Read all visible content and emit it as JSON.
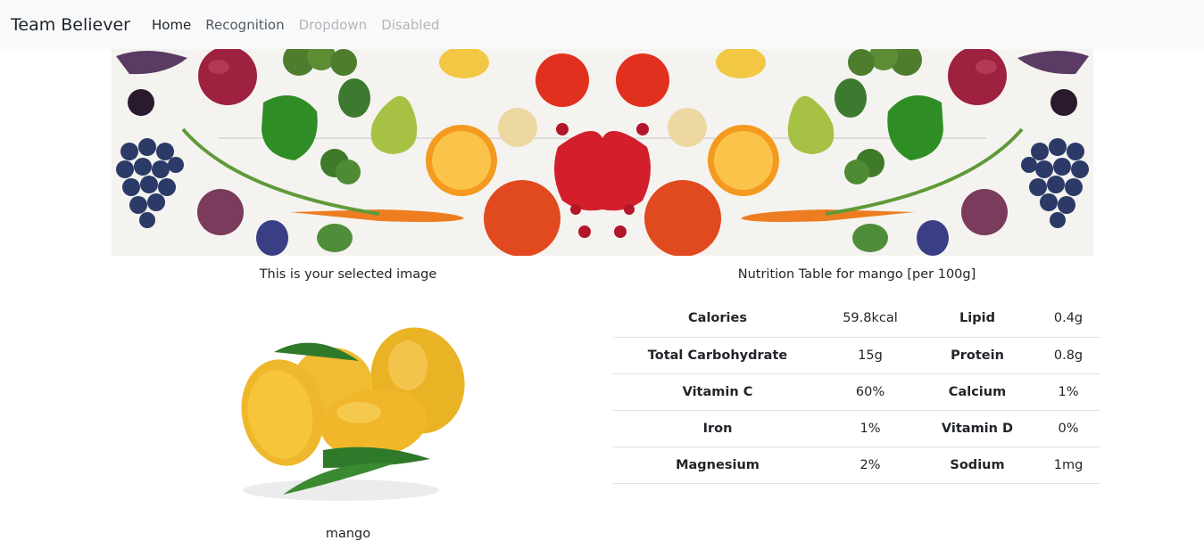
{
  "navbar": {
    "brand": "Team Believer",
    "links": [
      {
        "label": "Home",
        "state": "active"
      },
      {
        "label": "Recognition",
        "state": "normal"
      },
      {
        "label": "Dropdown",
        "state": "muted"
      },
      {
        "label": "Disabled",
        "state": "disabled"
      }
    ]
  },
  "banner": {
    "icon": "vegetables-banner-image"
  },
  "main": {
    "selected_caption": "This is your selected image",
    "selected_label": "mango",
    "table_title": "Nutrition Table for mango [per 100g]"
  },
  "nutrition": [
    {
      "name1": "Calories",
      "value1": "59.8kcal",
      "name2": "Lipid",
      "value2": "0.4g"
    },
    {
      "name1": "Total Carbohydrate",
      "value1": "15g",
      "name2": "Protein",
      "value2": "0.8g"
    },
    {
      "name1": "Vitamin C",
      "value1": "60%",
      "name2": "Calcium",
      "value2": "1%"
    },
    {
      "name1": "Iron",
      "value1": "1%",
      "name2": "Vitamin D",
      "value2": "0%"
    },
    {
      "name1": "Magnesium",
      "value1": "2%",
      "name2": "Sodium",
      "value2": "1mg"
    }
  ],
  "colors": {
    "navbar_bg": "#f8f9fa",
    "text": "#212529",
    "muted": "#b3b6b9",
    "border": "#dee2e6",
    "mango": "#f2b72a",
    "leaf": "#2f7a2a"
  }
}
